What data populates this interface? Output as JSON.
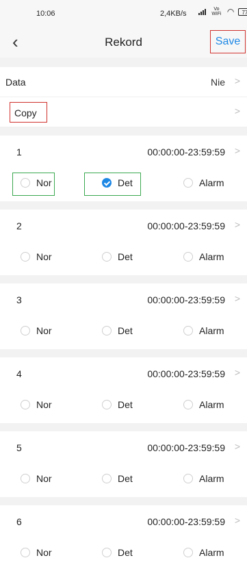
{
  "status": {
    "time": "10:06",
    "net_speed": "2,4KB/s",
    "vo_label": "Vo WiFi",
    "battery": "77"
  },
  "header": {
    "title": "Rekord",
    "save_label": "Save"
  },
  "settings": [
    {
      "label": "Data",
      "value": "Nie"
    },
    {
      "label": "Copy",
      "value": ""
    }
  ],
  "options": {
    "nor": "Nor",
    "det": "Det",
    "alarm": "Alarm"
  },
  "schedules": [
    {
      "num": "1",
      "time": "00:00:00-23:59:59",
      "selected": "Det"
    },
    {
      "num": "2",
      "time": "00:00:00-23:59:59",
      "selected": ""
    },
    {
      "num": "3",
      "time": "00:00:00-23:59:59",
      "selected": ""
    },
    {
      "num": "4",
      "time": "00:00:00-23:59:59",
      "selected": ""
    },
    {
      "num": "5",
      "time": "00:00:00-23:59:59",
      "selected": ""
    },
    {
      "num": "6",
      "time": "00:00:00-23:59:59",
      "selected": ""
    }
  ],
  "colors": {
    "accent": "#1e88e5",
    "highlight_red": "#d0312d",
    "highlight_green": "#3aa84f"
  }
}
